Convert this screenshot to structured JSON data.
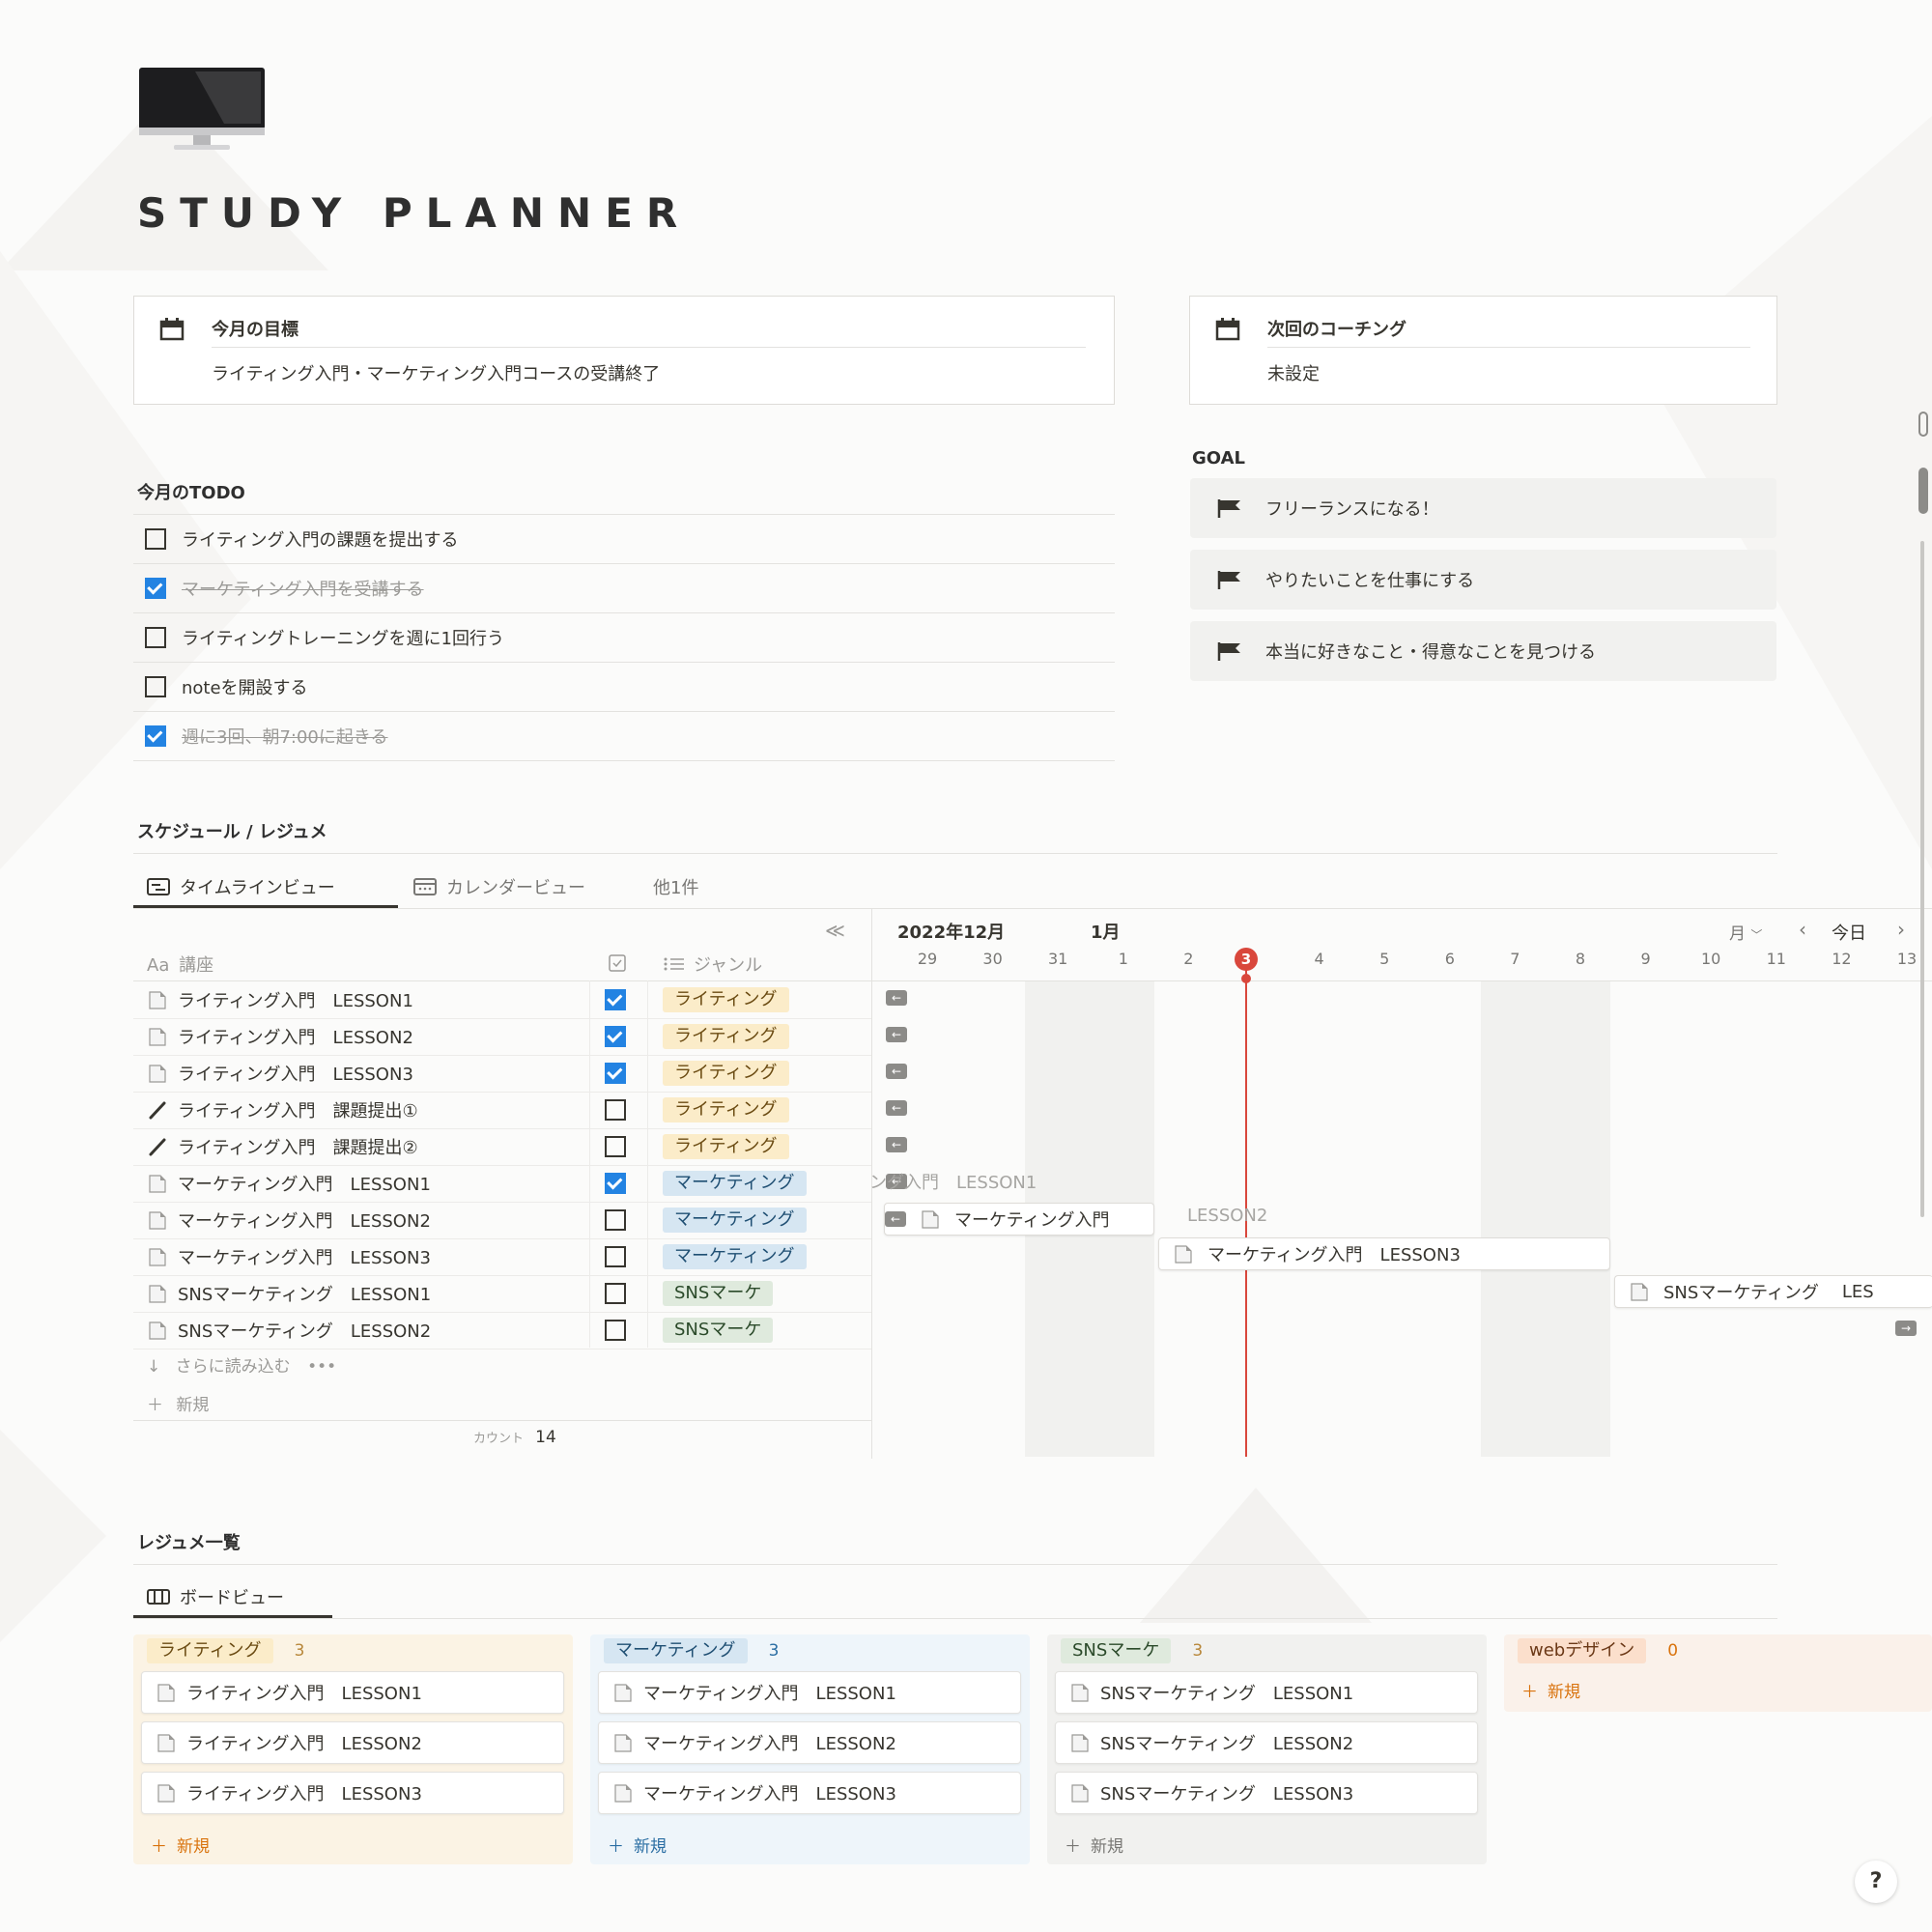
{
  "page": {
    "title": "STUDY PLANNER",
    "help": "?"
  },
  "cards": {
    "goal_month": {
      "label": "今月の目標",
      "value": "ライティング入門・マーケティング入門コースの受講終了"
    },
    "coaching": {
      "label": "次回のコーチング",
      "value": "未設定"
    }
  },
  "todo": {
    "title": "今月のTODO",
    "items": [
      {
        "text": "ライティング入門の課題を提出する",
        "checked": false
      },
      {
        "text": "マーケティング入門を受講する",
        "checked": true
      },
      {
        "text": "ライティングトレーニングを週に1回行う",
        "checked": false
      },
      {
        "text": "noteを開設する",
        "checked": false
      },
      {
        "text": "週に3回、朝7:00に起きる",
        "checked": true
      }
    ]
  },
  "goal": {
    "title": "GOAL",
    "items": [
      "フリーランスになる！",
      "やりたいことを仕事にする",
      "本当に好きなこと・得意なことを見つける"
    ]
  },
  "schedule": {
    "title": "スケジュール / レジュメ",
    "tabs": [
      "タイムラインビュー",
      "カレンダービュー",
      "他1件"
    ],
    "collapse": "≪",
    "columns": {
      "name": "講座",
      "name_prefix": "Aa",
      "genre": "ジャンル"
    },
    "rows": [
      {
        "name": "ライティング入門　LESSON1",
        "done": true,
        "genre": "ライティング",
        "icon": "doc"
      },
      {
        "name": "ライティング入門　LESSON2",
        "done": true,
        "genre": "ライティング",
        "icon": "doc"
      },
      {
        "name": "ライティング入門　LESSON3",
        "done": true,
        "genre": "ライティング",
        "icon": "doc"
      },
      {
        "name": "ライティング入門　課題提出①",
        "done": false,
        "genre": "ライティング",
        "icon": "pen"
      },
      {
        "name": "ライティング入門　課題提出②",
        "done": false,
        "genre": "ライティング",
        "icon": "pen"
      },
      {
        "name": "マーケティング入門　LESSON1",
        "done": true,
        "genre": "マーケティング",
        "icon": "doc"
      },
      {
        "name": "マーケティング入門　LESSON2",
        "done": false,
        "genre": "マーケティング",
        "icon": "doc"
      },
      {
        "name": "マーケティング入門　LESSON3",
        "done": false,
        "genre": "マーケティング",
        "icon": "doc"
      },
      {
        "name": "SNSマーケティング　LESSON1",
        "done": false,
        "genre": "SNSマーケ",
        "icon": "doc"
      },
      {
        "name": "SNSマーケティング　LESSON2",
        "done": false,
        "genre": "SNSマーケ",
        "icon": "doc"
      }
    ],
    "load_more": "さらに読み込む",
    "load_more_dots": "•••",
    "new": "新規",
    "count_label": "カウント",
    "count": "14",
    "timeline": {
      "month1": "2022年12月",
      "month2": "1月",
      "days": [
        "29",
        "30",
        "31",
        "1",
        "2",
        "3",
        "4",
        "5",
        "6",
        "7",
        "8",
        "9",
        "10",
        "11",
        "12",
        "13"
      ],
      "today_day": "3",
      "view_mode": "月",
      "today_label": "今日",
      "bars": {
        "m1_faded": "ング入門　LESSON1",
        "m2": "マーケティング入門",
        "m2_faded": "LESSON2",
        "m3": "マーケティング入門　LESSON3",
        "s1": "SNSマーケティング",
        "s1_tail": "LES"
      }
    }
  },
  "resume": {
    "title": "レジュメ一覧",
    "tab": "ボードビュー",
    "columns": [
      {
        "tag": "ライティング",
        "count": "3",
        "cards": [
          "ライティング入門　LESSON1",
          "ライティング入門　LESSON2",
          "ライティング入門　LESSON3"
        ],
        "new": "新規"
      },
      {
        "tag": "マーケティング",
        "count": "3",
        "cards": [
          "マーケティング入門　LESSON1",
          "マーケティング入門　LESSON2",
          "マーケティング入門　LESSON3"
        ],
        "new": "新規"
      },
      {
        "tag": "SNSマーケ",
        "count": "3",
        "cards": [
          "SNSマーケティング　LESSON1",
          "SNSマーケティング　LESSON2",
          "SNSマーケティング　LESSON3"
        ],
        "new": "新規"
      },
      {
        "tag": "webデザイン",
        "count": "0",
        "cards": [],
        "new": "新規"
      }
    ]
  },
  "colors": {
    "accent": "#2383e2",
    "today": "#d9473c",
    "orange": "#d9730d"
  }
}
